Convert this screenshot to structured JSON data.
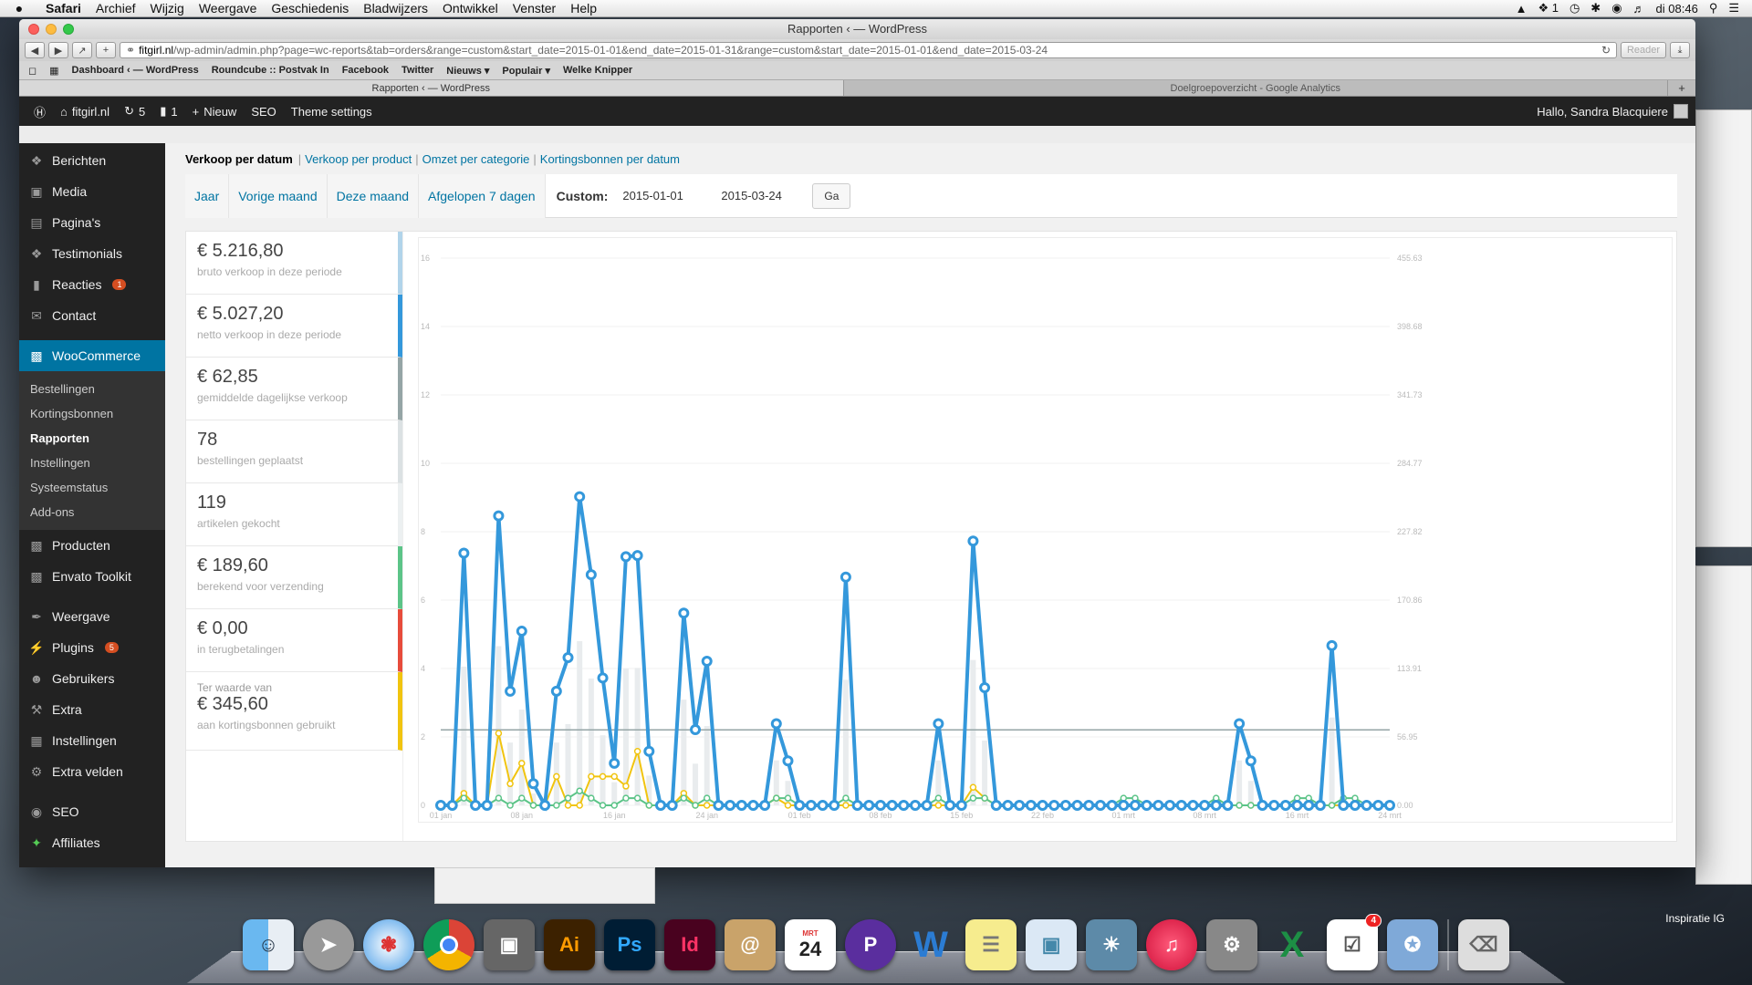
{
  "menubar": {
    "app": "Safari",
    "items": [
      "Archief",
      "Wijzig",
      "Weergave",
      "Geschiedenis",
      "Bladwijzers",
      "Ontwikkel",
      "Venster",
      "Help"
    ],
    "clock": "di 08:46",
    "status_1": "1"
  },
  "window": {
    "title": "Rapporten ‹ — WordPress",
    "url_host": "fitgirl.nl",
    "url_rest": "/wp-admin/admin.php?page=wc-reports&tab=orders&range=custom&start_date=2015-01-01&end_date=2015-01-31&range=custom&start_date=2015-01-01&end_date=2015-03-24",
    "reader": "Reader"
  },
  "bookmarks": [
    "Dashboard ‹ — WordPress",
    "Roundcube :: Postvak In",
    "Facebook",
    "Twitter",
    "Nieuws ▾",
    "Populair ▾",
    "Welke Knipper"
  ],
  "tabs": [
    "Rapporten ‹ — WordPress",
    "Doelgroepoverzicht - Google Analytics"
  ],
  "adminbar": {
    "site": "fitgirl.nl",
    "updates": "5",
    "comments": "1",
    "new": "Nieuw",
    "seo": "SEO",
    "theme": "Theme settings",
    "greeting": "Hallo, Sandra Blacquiere"
  },
  "sidebar": {
    "top": [
      {
        "label": "Berichten",
        "icon": "pin-icon"
      },
      {
        "label": "Media",
        "icon": "media-icon"
      },
      {
        "label": "Pagina's",
        "icon": "page-icon"
      },
      {
        "label": "Testimonials",
        "icon": "pin-icon"
      },
      {
        "label": "Reacties",
        "icon": "comment-icon",
        "badge": "1"
      },
      {
        "label": "Contact",
        "icon": "mail-icon"
      }
    ],
    "woocommerce": "WooCommerce",
    "woo_sub": [
      "Bestellingen",
      "Kortingsbonnen",
      "Rapporten",
      "Instellingen",
      "Systeemstatus",
      "Add-ons"
    ],
    "mid": [
      {
        "label": "Producten",
        "icon": "product-icon"
      },
      {
        "label": "Envato Toolkit",
        "icon": "toolkit-icon"
      }
    ],
    "bottom": [
      {
        "label": "Weergave",
        "icon": "brush-icon"
      },
      {
        "label": "Plugins",
        "icon": "plug-icon",
        "badge": "5"
      },
      {
        "label": "Gebruikers",
        "icon": "users-icon"
      },
      {
        "label": "Extra",
        "icon": "wrench-icon"
      },
      {
        "label": "Instellingen",
        "icon": "settings-icon"
      },
      {
        "label": "Extra velden",
        "icon": "gear-icon"
      }
    ],
    "last": [
      {
        "label": "SEO",
        "icon": "seo-icon"
      },
      {
        "label": "Affiliates",
        "icon": "affiliates-icon"
      }
    ]
  },
  "report_nav": {
    "current": "Verkoop per datum",
    "links": [
      "Verkoop per product",
      "Omzet per categorie",
      "Kortingsbonnen per datum"
    ]
  },
  "ranges": {
    "items": [
      "Jaar",
      "Vorige maand",
      "Deze maand",
      "Afgelopen 7 dagen"
    ],
    "custom_label": "Custom:",
    "start": "2015-01-01",
    "end": "2015-03-24",
    "go": "Ga"
  },
  "legend": [
    {
      "value": "€ 5.216,80",
      "desc": "bruto verkoop in deze periode",
      "color": "#b1d4ea"
    },
    {
      "value": "€ 5.027,20",
      "desc": "netto verkoop in deze periode",
      "color": "#3498db"
    },
    {
      "value": "€ 62,85",
      "desc": "gemiddelde dagelijkse verkoop",
      "color": "#95a5a6"
    },
    {
      "value": "78",
      "desc": "bestellingen geplaatst",
      "color": "#dbe1e3"
    },
    {
      "value": "119",
      "desc": "artikelen gekocht",
      "color": "#ecf0f1"
    },
    {
      "value": "€ 189,60",
      "desc": "berekend voor verzending",
      "color": "#5cc488"
    },
    {
      "value": "€ 0,00",
      "desc": "in terugbetalingen",
      "color": "#e74c3c"
    },
    {
      "pre": "Ter waarde van",
      "value": "€ 345,60",
      "desc": "aan kortingsbonnen gebruikt",
      "color": "#f1c40f"
    }
  ],
  "chart_data": {
    "type": "line",
    "x_ticks": [
      "01 jan",
      "08 jan",
      "16 jan",
      "24 jan",
      "01 feb",
      "08 feb",
      "15 feb",
      "22 feb",
      "01 mrt",
      "08 mrt",
      "16 mrt",
      "24 mrt"
    ],
    "y_left_ticks": [
      "0",
      "2",
      "4",
      "6",
      "8",
      "10",
      "12",
      "14",
      "16"
    ],
    "y_right_ticks": [
      "0.00",
      "56.95",
      "113.91",
      "170.86",
      "227.82",
      "284.77",
      "341.73",
      "398.68",
      "455.63"
    ],
    "y_left_range": [
      0,
      16
    ],
    "y_right_range": [
      0,
      455.63
    ],
    "average_line": 62.85,
    "days": 83,
    "series": [
      {
        "name": "netto verkoop in deze periode",
        "color": "#3498db",
        "values": [
          0,
          0,
          210,
          0,
          0,
          241,
          95,
          145,
          18,
          0,
          95,
          123,
          257,
          192,
          106,
          35,
          207,
          208,
          45,
          0,
          0,
          160,
          63,
          120,
          0,
          0,
          0,
          0,
          0,
          68,
          37,
          0,
          0,
          0,
          0,
          190,
          0,
          0,
          0,
          0,
          0,
          0,
          0,
          68,
          0,
          0,
          220,
          98,
          0,
          0,
          0,
          0,
          0,
          0,
          0,
          0,
          0,
          0,
          0,
          0,
          0,
          0,
          0,
          0,
          0,
          0,
          0,
          0,
          0,
          68,
          37,
          0,
          0,
          0,
          0,
          0,
          0,
          133,
          0,
          0,
          0,
          0,
          0,
          0,
          0,
          0,
          0,
          0,
          0,
          0,
          0,
          0,
          0,
          0,
          0,
          0,
          0,
          0,
          0,
          0,
          0,
          0,
          0,
          0,
          0,
          0,
          0,
          0,
          0,
          0,
          0,
          0,
          0,
          0,
          0,
          0,
          0,
          0,
          0,
          0,
          0,
          0,
          0,
          0,
          0,
          0,
          0,
          0,
          0,
          0,
          0,
          0,
          0,
          0,
          0,
          0,
          0,
          0,
          0,
          0,
          0,
          0,
          0,
          0,
          0,
          0,
          0,
          0,
          0,
          0,
          0,
          0,
          0,
          0,
          0,
          0,
          0,
          0,
          0,
          0,
          0,
          0,
          0,
          0,
          0,
          0,
          0
        ]
      },
      {
        "name": "berekend voor verzending",
        "color": "#5cc488",
        "values": [
          0,
          0,
          6,
          0,
          0,
          6,
          0,
          6,
          0,
          0,
          0,
          6,
          12,
          6,
          0,
          0,
          6,
          6,
          0,
          0,
          0,
          6,
          0,
          6,
          0,
          0,
          0,
          0,
          0,
          6,
          6,
          0,
          0,
          0,
          0,
          6,
          0,
          0,
          0,
          0,
          0,
          0,
          0,
          6,
          0,
          0,
          6,
          6,
          0,
          0,
          0,
          0,
          0,
          0,
          0,
          0,
          0,
          0,
          0,
          6,
          6,
          0,
          0,
          0,
          0,
          0,
          0,
          6,
          0,
          0,
          0,
          0,
          0,
          0,
          6,
          6,
          0,
          0,
          6,
          6,
          0,
          0,
          0,
          0
        ]
      },
      {
        "name": "aan kortingsbonnen gebruikt",
        "color": "#f1c40f",
        "values": [
          0,
          0,
          10,
          0,
          0,
          60,
          18,
          35,
          0,
          0,
          24,
          0,
          0,
          24,
          24,
          24,
          16,
          45,
          0,
          0,
          0,
          10,
          0,
          0,
          0,
          0,
          0,
          0,
          0,
          6,
          0,
          0,
          0,
          0,
          0,
          0,
          0,
          0,
          0,
          0,
          0,
          0,
          0,
          0,
          0,
          0,
          15,
          6,
          0,
          0,
          0,
          0,
          0,
          0,
          0,
          0,
          0,
          0,
          0,
          0,
          0,
          0,
          0,
          0,
          0,
          0,
          0,
          0,
          0,
          0,
          0,
          0,
          0,
          0,
          0,
          0,
          0,
          0,
          0,
          0,
          0,
          0,
          0,
          0
        ]
      }
    ]
  },
  "dock": {
    "calendar_day": "24",
    "calendar_month": "MRT",
    "reminders_badge": "4",
    "insp": "Inspiratie IG"
  },
  "colors": {
    "accent": "#0074a2",
    "adminbar": "#222222",
    "line": "#3498db"
  }
}
